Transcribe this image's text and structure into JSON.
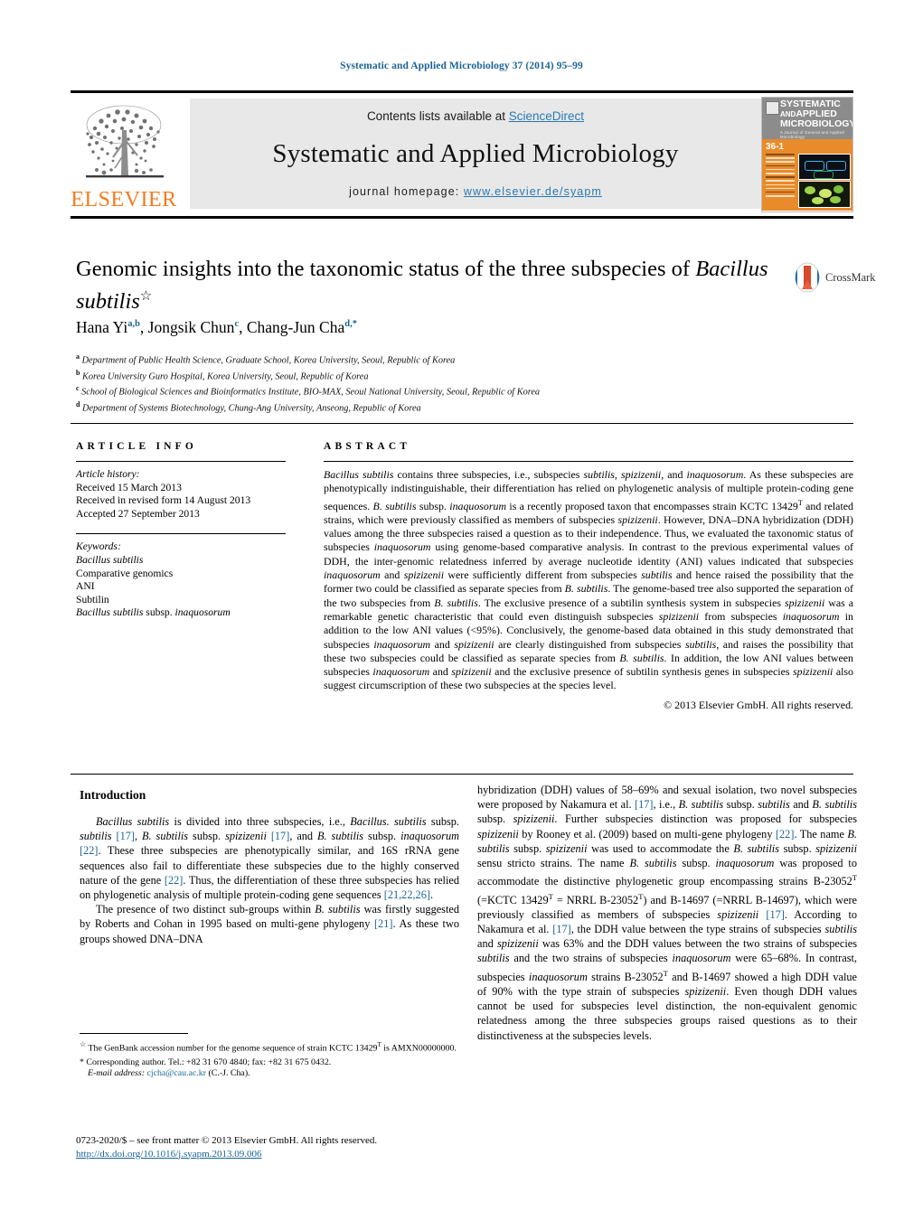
{
  "running_head": "Systematic and Applied Microbiology 37 (2014) 95–99",
  "masthead": {
    "publisher_name": "ELSEVIER",
    "contents_prefix": "Contents lists available at ",
    "contents_link": "ScienceDirect",
    "journal_name": "Systematic and Applied Microbiology",
    "homepage_label": "journal homepage:",
    "homepage_url": "www.elsevier.de/syapm",
    "cover": {
      "line1": "SYSTEMATIC",
      "line2_small": "AND",
      "line2": "APPLIED",
      "line3": "MICROBIOLOGY",
      "tagline": "A Journal of General and Applied Microbiology",
      "volume": "36-1"
    }
  },
  "article": {
    "title_part1": "Genomic insights into the taxonomic status of the three subspecies of ",
    "title_italic": "Bacillus subtilis",
    "title_marker": "☆",
    "crossmark_label": "CrossMark",
    "authors": [
      {
        "name": "Hana Yi",
        "sup": "a,b"
      },
      {
        "name": "Jongsik Chun",
        "sup": "c"
      },
      {
        "name": "Chang-Jun Cha",
        "sup": "d,",
        "asterisk": "*"
      }
    ],
    "affiliations": [
      {
        "mark": "a",
        "text": "Department of Public Health Science, Graduate School, Korea University, Seoul, Republic of Korea"
      },
      {
        "mark": "b",
        "text": "Korea University Guro Hospital, Korea University, Seoul, Republic of Korea"
      },
      {
        "mark": "c",
        "text": "School of Biological Sciences and Bioinformatics Institute, BIO-MAX, Seoul National University, Seoul, Republic of Korea"
      },
      {
        "mark": "d",
        "text": "Department of Systems Biotechnology, Chung-Ang University, Anseong, Republic of Korea"
      }
    ]
  },
  "article_info": {
    "heading": "ARTICLE INFO",
    "history_label": "Article history:",
    "history": [
      "Received 15 March 2013",
      "Received in revised form 14 August 2013",
      "Accepted 27 September 2013"
    ],
    "keywords_label": "Keywords:",
    "keywords": [
      "Bacillus subtilis",
      "Comparative genomics",
      "ANI",
      "Subtilin",
      "Bacillus subtilis subsp. inaquosorum"
    ]
  },
  "abstract": {
    "heading": "ABSTRACT",
    "copyright": "© 2013 Elsevier GmbH. All rights reserved."
  },
  "introduction": {
    "heading": "Introduction"
  },
  "footnotes": {
    "genbank": "The GenBank accession number for the genome sequence of strain KCTC 13429",
    "genbank_sup": "T",
    "genbank_tail": " is AMXN00000000.",
    "corresponding": "Corresponding author. Tel.: +82 31 670 4840; fax: +82 31 675 0432.",
    "email_label": "E-mail address:",
    "email": "cjcha@cau.ac.kr",
    "email_tail": " (C.-J. Cha)."
  },
  "imprint": {
    "line1": "0723-2020/$ – see front matter © 2013 Elsevier GmbH. All rights reserved.",
    "doi": "http://dx.doi.org/10.1016/j.syapm.2013.09.006"
  },
  "colors": {
    "link": "#1a6496",
    "elsevier_orange": "#F47B20",
    "masthead_bg": "#e8e8e8",
    "cover_orange": "#E98B2A"
  }
}
